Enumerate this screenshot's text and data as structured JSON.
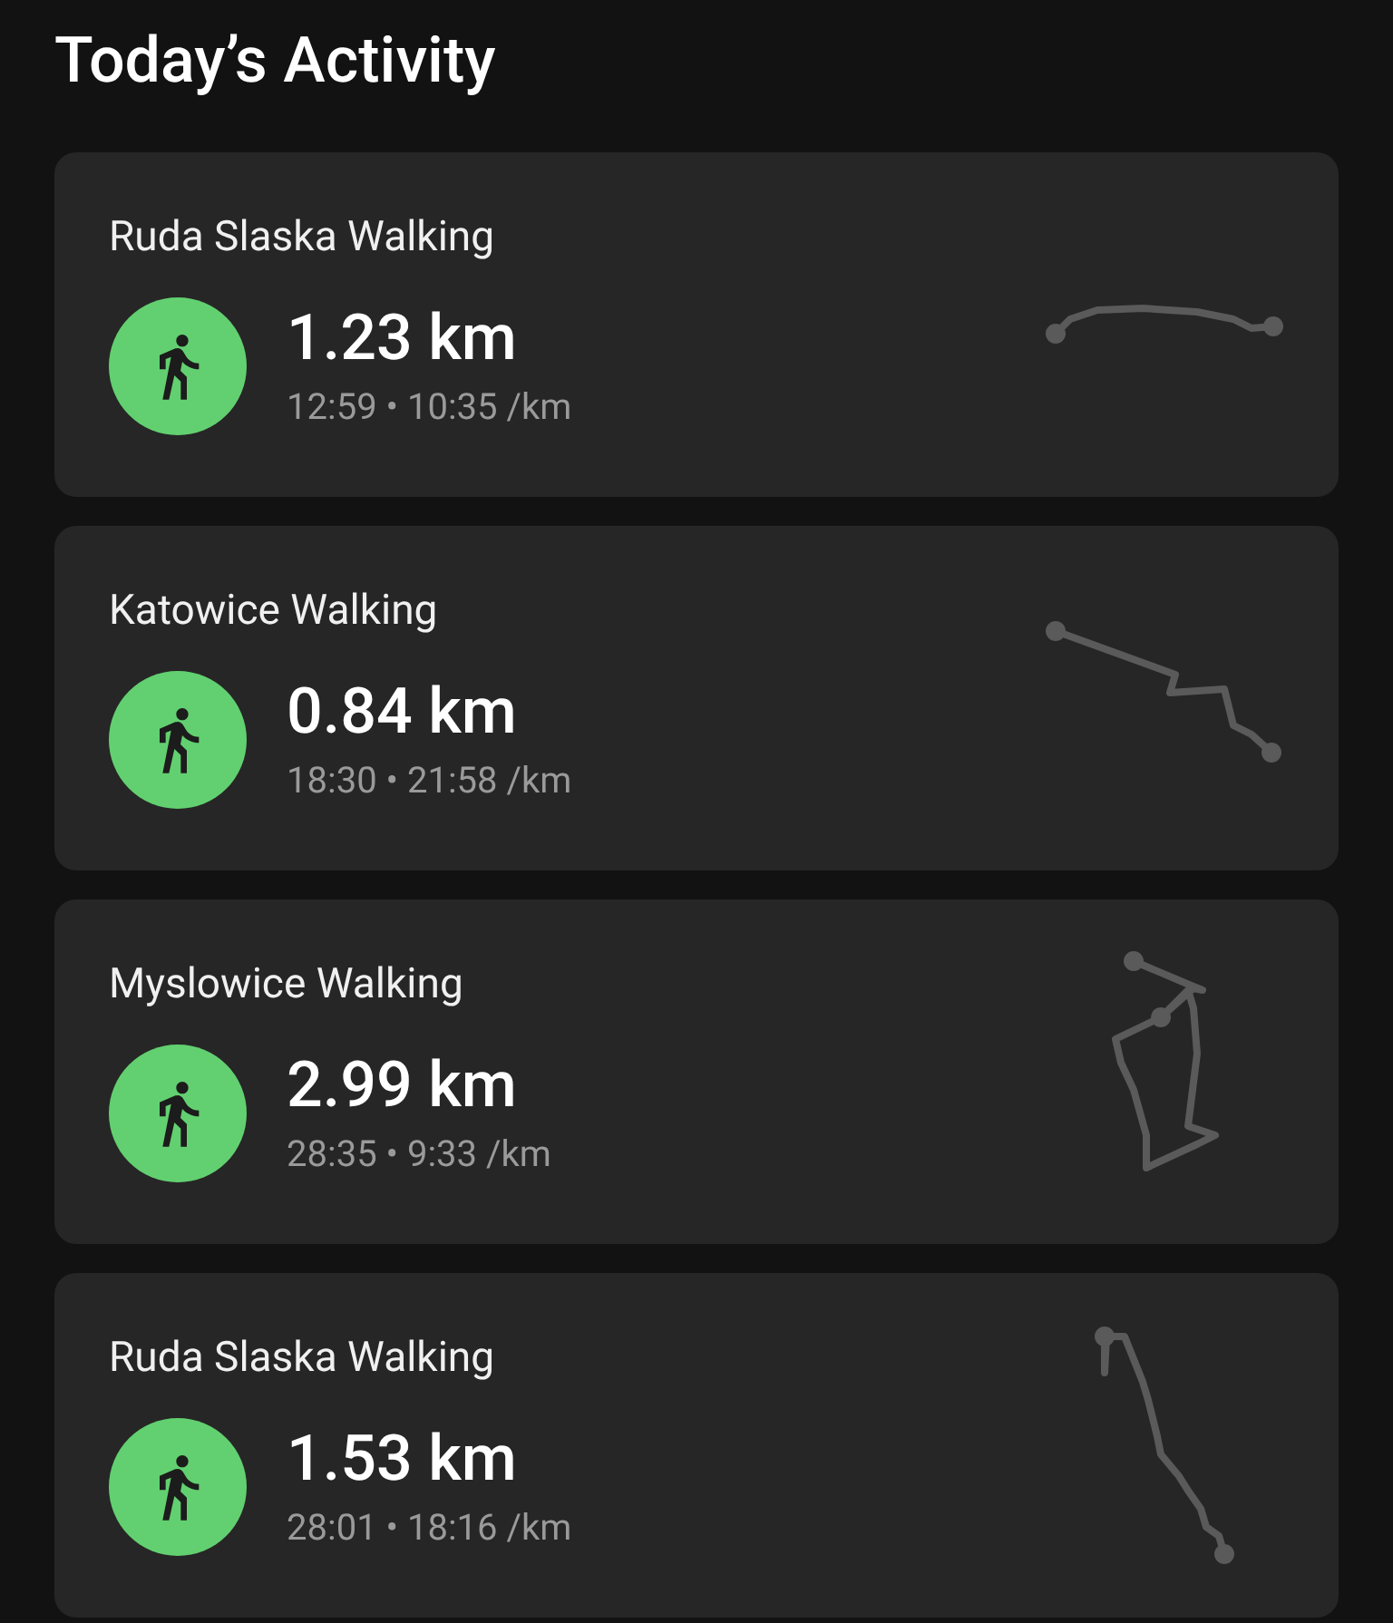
{
  "title": "Today’s Activity",
  "activities": [
    {
      "name": "Ruda Slaska Walking",
      "distance": "1.23 km",
      "duration": "12:59",
      "pace": "10:35 /km",
      "separator": "•"
    },
    {
      "name": "Katowice Walking",
      "distance": "0.84 km",
      "duration": "18:30",
      "pace": "21:58 /km",
      "separator": "•"
    },
    {
      "name": "Myslowice Walking",
      "distance": "2.99 km",
      "duration": "28:35",
      "pace": "9:33 /km",
      "separator": "•"
    },
    {
      "name": "Ruda Slaska Walking",
      "distance": "1.53 km",
      "duration": "28:01",
      "pace": "18:16 /km",
      "separator": "•"
    }
  ]
}
